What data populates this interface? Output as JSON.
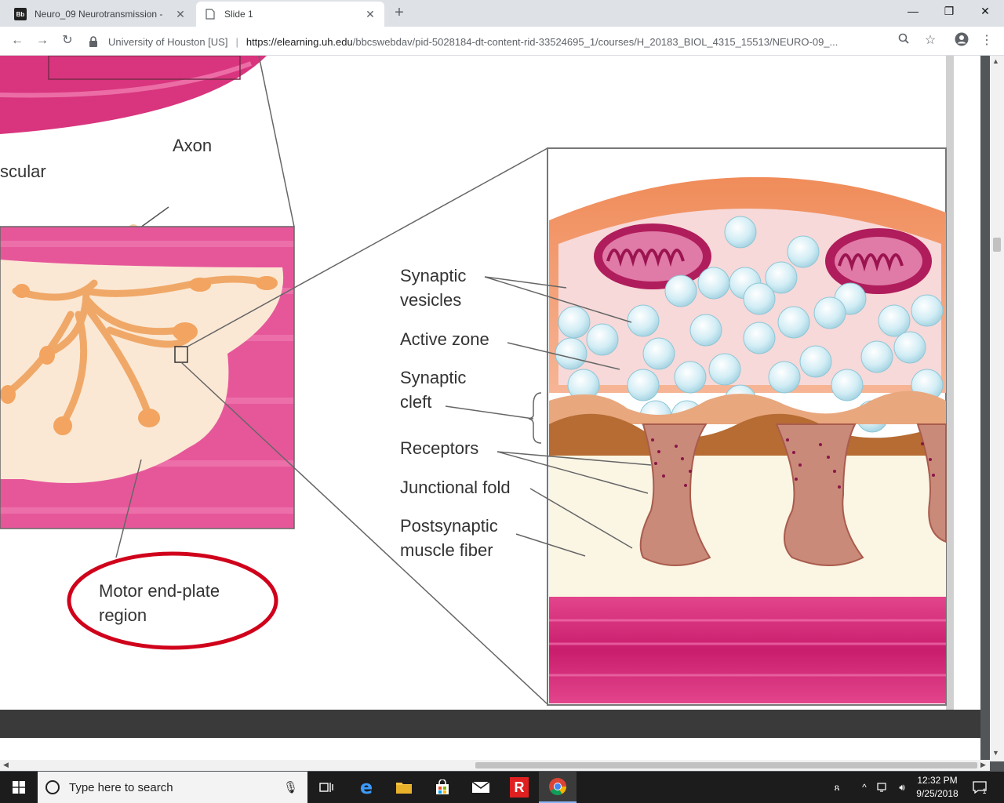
{
  "browser": {
    "tabs": [
      {
        "title": "Neuro_09 Neurotransmission -",
        "favicon": "Bb"
      },
      {
        "title": "Slide 1"
      }
    ],
    "site_info": "University of Houston [US]",
    "url_host": "https://elearning.uh.edu",
    "url_path": "/bbcswebdav/pid-5028184-dt-content-rid-33524695_1/courses/H_20183_BIOL_4315_15513/NEURO-09_..."
  },
  "slide": {
    "labels": {
      "axon": "Axon",
      "muscular": "scular",
      "synaptic_vesicles_1": "Synaptic",
      "synaptic_vesicles_2": "vesicles",
      "active_zone": "Active zone",
      "synaptic_cleft_1": "Synaptic",
      "synaptic_cleft_2": "cleft",
      "receptors": "Receptors",
      "junctional_fold": "Junctional fold",
      "postsynaptic_1": "Postsynaptic",
      "postsynaptic_2": "muscle fiber",
      "motor_endplate_1": "Motor end-plate",
      "motor_endplate_2": "region"
    },
    "highlight_color": "#d0021b",
    "muscle_color": "#d9307a",
    "vesicle_color": "#cfeaf2"
  },
  "taskbar": {
    "search_placeholder": "Type here to search",
    "time": "12:32 PM",
    "date": "9/25/2018",
    "notification_count": "1"
  }
}
